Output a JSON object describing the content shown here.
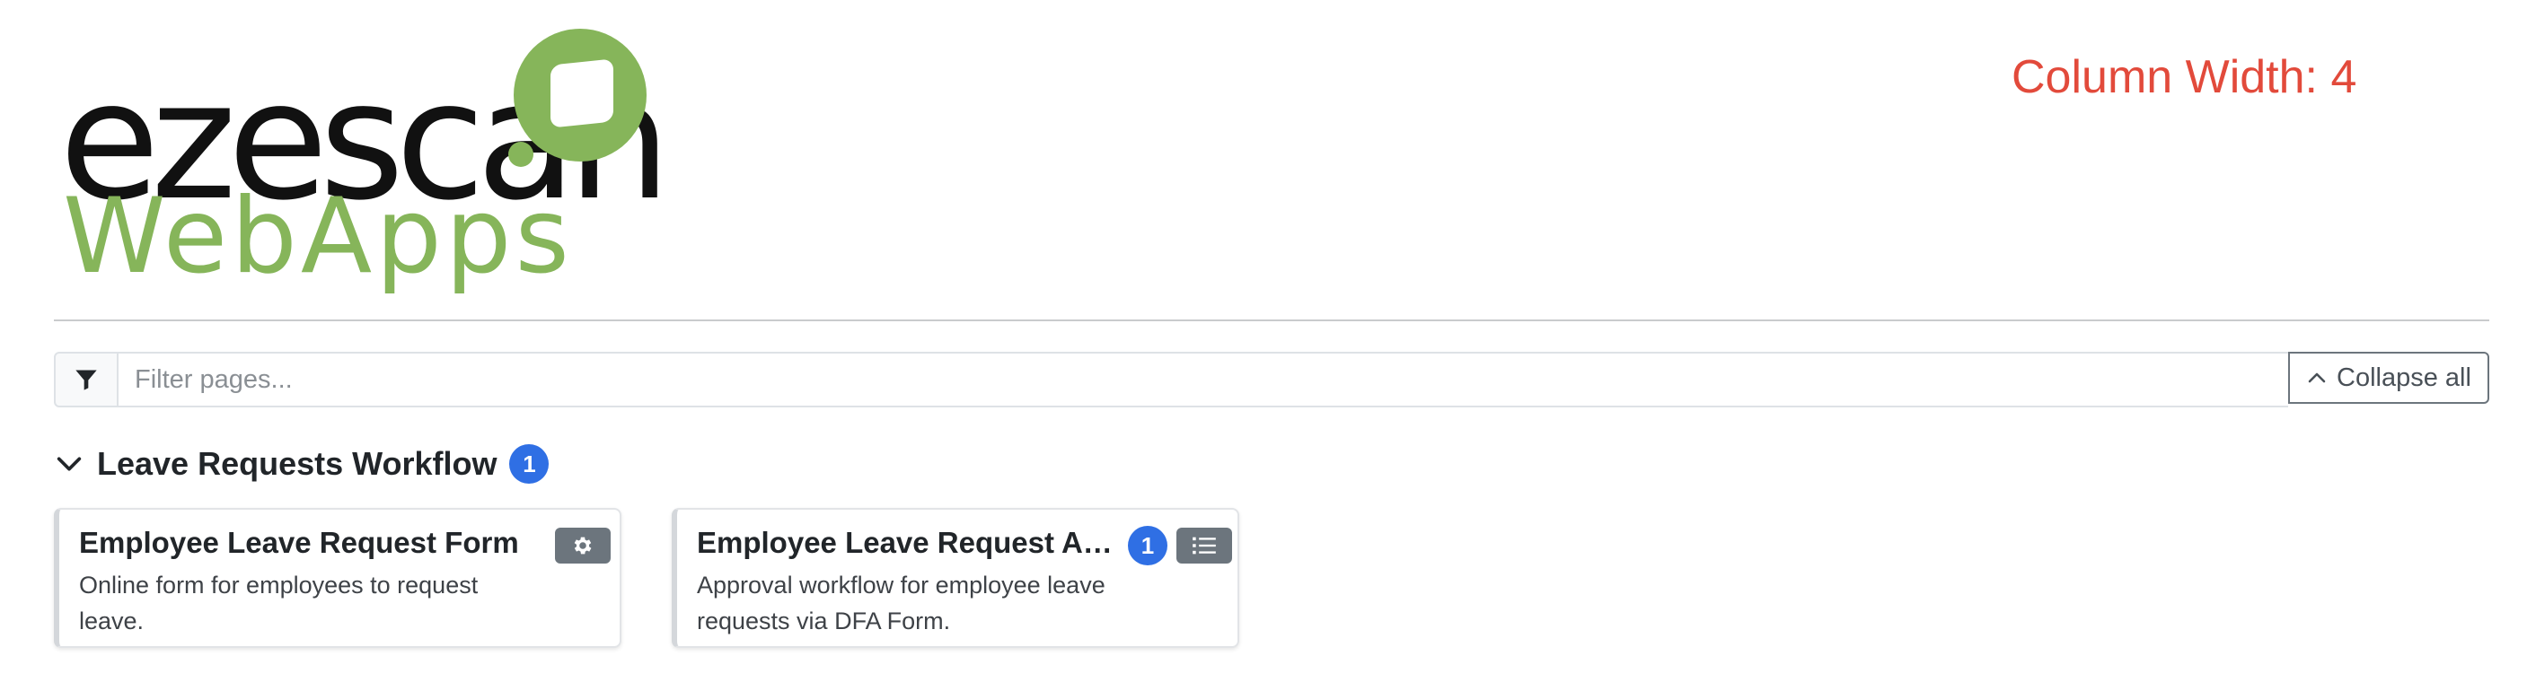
{
  "header": {
    "logo_word": "ezescan",
    "logo_sub": "WebApps",
    "column_width_label": "Column Width: 4"
  },
  "filter": {
    "placeholder": "Filter pages...",
    "value": "",
    "collapse_label": "Collapse all",
    "icon": "filter-icon"
  },
  "section": {
    "title": "Leave Requests Workflow",
    "badge": "1",
    "toggle_icon": "chevron-down-icon"
  },
  "cards": [
    {
      "title": "Employee Leave Request Form",
      "description": "Online form for employees to request leave.",
      "icon": "gear-icon"
    },
    {
      "title": "Employee Leave Request Ap...",
      "description": "Approval workflow for employee leave requests via DFA Form.",
      "badge": "1",
      "icon": "list-icon"
    }
  ],
  "colors": {
    "brand_green": "#86b55a",
    "badge_blue": "#2f6fe4",
    "accent_red": "#e24a3b",
    "button_gray": "#6c757d"
  }
}
